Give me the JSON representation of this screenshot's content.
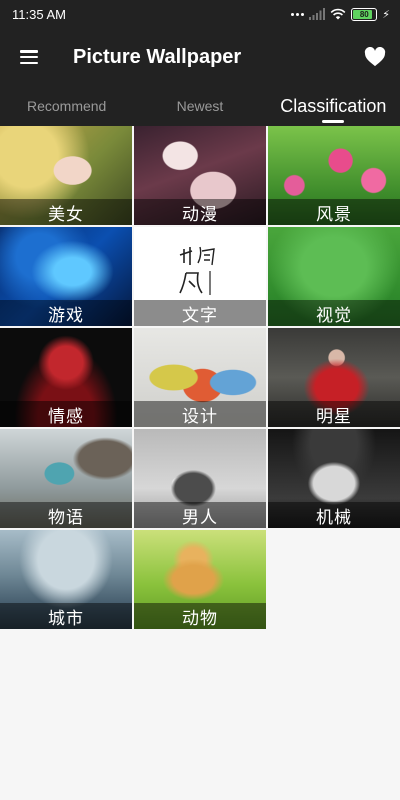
{
  "status_bar": {
    "time": "11:35 AM",
    "battery": "80",
    "icons": [
      "signal-dots-icon",
      "signal-icon",
      "wifi-icon",
      "battery-icon",
      "charging-icon"
    ]
  },
  "app_bar": {
    "title": "Picture Wallpaper",
    "menu_icon": "hamburger-menu-icon",
    "favorite_icon": "heart-icon"
  },
  "tabs": [
    {
      "label": "Recommend",
      "active": false
    },
    {
      "label": "Newest",
      "active": false
    },
    {
      "label": "Classification",
      "active": true
    }
  ],
  "categories": [
    {
      "label": "美女"
    },
    {
      "label": "动漫"
    },
    {
      "label": "风景"
    },
    {
      "label": "游戏"
    },
    {
      "label": "文字"
    },
    {
      "label": "视觉"
    },
    {
      "label": "情感"
    },
    {
      "label": "设计"
    },
    {
      "label": "明星"
    },
    {
      "label": "物语"
    },
    {
      "label": "男人"
    },
    {
      "label": "机械"
    },
    {
      "label": "城市"
    },
    {
      "label": "动物"
    }
  ],
  "colors": {
    "bar_background": "#222222",
    "page_background": "#f6f6f6",
    "tab_inactive": "#9a9a9a",
    "tab_active": "#ffffff",
    "battery_fill": "#5fd35f"
  }
}
